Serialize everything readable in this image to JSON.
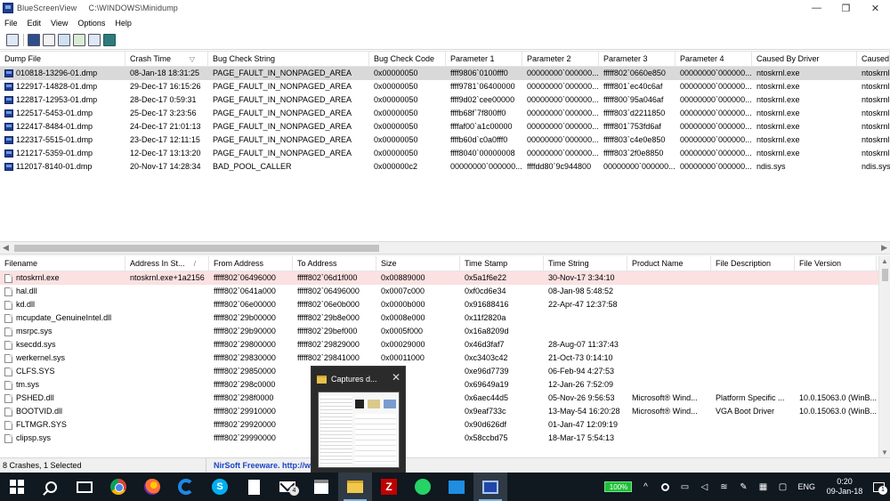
{
  "window": {
    "app_name": "BlueScreenView",
    "path": "C:\\WINDOWS\\Minidump",
    "controls": {
      "minimize": "—",
      "restore": "❐",
      "close": "✕"
    }
  },
  "menu": [
    "File",
    "Edit",
    "View",
    "Options",
    "Help"
  ],
  "toolbar": {
    "icons": [
      "properties-icon",
      "save-icon",
      "copy-icon",
      "copy-html-icon",
      "advanced-options-icon",
      "refresh-icon",
      "exit-icon"
    ]
  },
  "upper_table": {
    "columns": [
      "Dump File",
      "Crash Time",
      "Bug Check String",
      "Bug Check Code",
      "Parameter 1",
      "Parameter 2",
      "Parameter 3",
      "Parameter 4",
      "Caused By Driver",
      "Caused"
    ],
    "sort_indicator": "▽",
    "rows": [
      [
        "010818-13296-01.dmp",
        "08-Jan-18 18:31:25",
        "PAGE_FAULT_IN_NONPAGED_AREA",
        "0x00000050",
        "ffff9806`0100fff0",
        "00000000`000000...",
        "fffff802`0660e850",
        "00000000`000000...",
        "ntoskrnl.exe",
        "ntoskrnl"
      ],
      [
        "122917-14828-01.dmp",
        "29-Dec-17 16:15:26",
        "PAGE_FAULT_IN_NONPAGED_AREA",
        "0x00000050",
        "ffff9781`06400000",
        "00000000`000000...",
        "fffff801`ec40c6af",
        "00000000`000000...",
        "ntoskrnl.exe",
        "ntoskrnl"
      ],
      [
        "122817-12953-01.dmp",
        "28-Dec-17 0:59:31",
        "PAGE_FAULT_IN_NONPAGED_AREA",
        "0x00000050",
        "ffff9d02`cee00000",
        "00000000`000000...",
        "fffff800`95a046af",
        "00000000`000000...",
        "ntoskrnl.exe",
        "ntoskrnl"
      ],
      [
        "122517-5453-01.dmp",
        "25-Dec-17 3:23:56",
        "PAGE_FAULT_IN_NONPAGED_AREA",
        "0x00000050",
        "ffffb68f`7f800ff0",
        "00000000`000000...",
        "fffff803`d2211850",
        "00000000`000000...",
        "ntoskrnl.exe",
        "ntoskrnl"
      ],
      [
        "122417-8484-01.dmp",
        "24-Dec-17 21:01:13",
        "PAGE_FAULT_IN_NONPAGED_AREA",
        "0x00000050",
        "ffffaf00`a1c00000",
        "00000000`000000...",
        "fffff801`753fd6af",
        "00000000`000000...",
        "ntoskrnl.exe",
        "ntoskrnl"
      ],
      [
        "122317-5515-01.dmp",
        "23-Dec-17 12:11:15",
        "PAGE_FAULT_IN_NONPAGED_AREA",
        "0x00000050",
        "ffffb60d`c0a0fff0",
        "00000000`000000...",
        "fffff803`c4e0e850",
        "00000000`000000...",
        "ntoskrnl.exe",
        "ntoskrnl"
      ],
      [
        "121217-5359-01.dmp",
        "12-Dec-17 13:13:20",
        "PAGE_FAULT_IN_NONPAGED_AREA",
        "0x00000050",
        "ffff8040`00000008",
        "00000000`000000...",
        "fffff803`2f0e8850",
        "00000000`000000...",
        "ntoskrnl.exe",
        "ntoskrnl"
      ],
      [
        "112017-8140-01.dmp",
        "20-Nov-17 14:28:34",
        "BAD_POOL_CALLER",
        "0x000000c2",
        "00000000`000000...",
        "ffffdd80`9c944800",
        "00000000`000000...",
        "00000000`000000...",
        "ndis.sys",
        "ndis.sys"
      ]
    ]
  },
  "lower_table": {
    "columns": [
      "Filename",
      "Address In St...",
      "From Address",
      "To Address",
      "Size",
      "Time Stamp",
      "Time String",
      "Product Name",
      "File Description",
      "File Version"
    ],
    "sort_indicator": "/",
    "rows": [
      [
        "ntoskrnl.exe",
        "ntoskrnl.exe+1a2156",
        "fffff802`06496000",
        "fffff802`06d1f000",
        "0x00889000",
        "0x5a1f6e22",
        "30-Nov-17 3:34:10",
        "",
        "",
        ""
      ],
      [
        "hal.dll",
        "",
        "fffff802`0641a000",
        "fffff802`06496000",
        "0x0007c000",
        "0xf0cd6e34",
        "08-Jan-98 5:48:52",
        "",
        "",
        ""
      ],
      [
        "kd.dll",
        "",
        "fffff802`06e00000",
        "fffff802`06e0b000",
        "0x0000b000",
        "0x91688416",
        "22-Apr-47 12:37:58",
        "",
        "",
        ""
      ],
      [
        "mcupdate_GenuineIntel.dll",
        "",
        "fffff802`29b00000",
        "fffff802`29b8e000",
        "0x0008e000",
        "0x11f2820a",
        "",
        "",
        "",
        ""
      ],
      [
        "msrpc.sys",
        "",
        "fffff802`29b90000",
        "fffff802`29bef000",
        "0x0005f000",
        "0x16a8209d",
        "",
        "",
        "",
        ""
      ],
      [
        "ksecdd.sys",
        "",
        "fffff802`29800000",
        "fffff802`29829000",
        "0x00029000",
        "0x46d3faf7",
        "28-Aug-07 11:37:43",
        "",
        "",
        ""
      ],
      [
        "werkernel.sys",
        "",
        "fffff802`29830000",
        "fffff802`29841000",
        "0x00011000",
        "0xc3403c42",
        "21-Oct-73 0:14:10",
        "",
        "",
        ""
      ],
      [
        "CLFS.SYS",
        "",
        "fffff802`29850000",
        "",
        "",
        "0xe96d7739",
        "06-Feb-94 4:27:53",
        "",
        "",
        ""
      ],
      [
        "tm.sys",
        "",
        "fffff802`298c0000",
        "",
        "",
        "0x69649a19",
        "12-Jan-26 7:52:09",
        "",
        "",
        ""
      ],
      [
        "PSHED.dll",
        "",
        "fffff802`298f0000",
        "",
        "",
        "0x6aec44d5",
        "05-Nov-26 9:56:53",
        "Microsoft® Wind...",
        "Platform Specific ...",
        "10.0.15063.0 (WinB..."
      ],
      [
        "BOOTVID.dll",
        "",
        "fffff802`29910000",
        "",
        "",
        "0x9eaf733c",
        "13-May-54 16:20:28",
        "Microsoft® Wind...",
        "VGA Boot Driver",
        "10.0.15063.0 (WinB..."
      ],
      [
        "FLTMGR.SYS",
        "",
        "fffff802`29920000",
        "",
        "",
        "0x90d626df",
        "01-Jan-47 12:09:19",
        "",
        "",
        ""
      ],
      [
        "clipsp.sys",
        "",
        "fffff802`29990000",
        "",
        "",
        "0x58ccbd75",
        "18-Mar-17 5:54:13",
        "",
        "",
        ""
      ]
    ]
  },
  "status": {
    "summary": "8 Crashes, 1 Selected",
    "link": "NirSoft Freeware.  http://w"
  },
  "thumbnail": {
    "title": "Captures d...",
    "close": "✕"
  },
  "taskbar": {
    "mail_badge": "4",
    "battery": "100%",
    "language": "ENG",
    "time": "0:20",
    "date": "09-Jan-18",
    "notification_count": "1",
    "tray_icons": [
      "chevron-up-icon",
      "android-icon",
      "device-icon",
      "volume-icon",
      "wifi-icon",
      "pen-icon",
      "keyboard-icon",
      "message-icon"
    ]
  },
  "colors": {
    "selected_row": "#d9d9d9",
    "highlight_row": "#fbe1e1",
    "link": "#1a44c5",
    "taskbar": "#101820"
  }
}
